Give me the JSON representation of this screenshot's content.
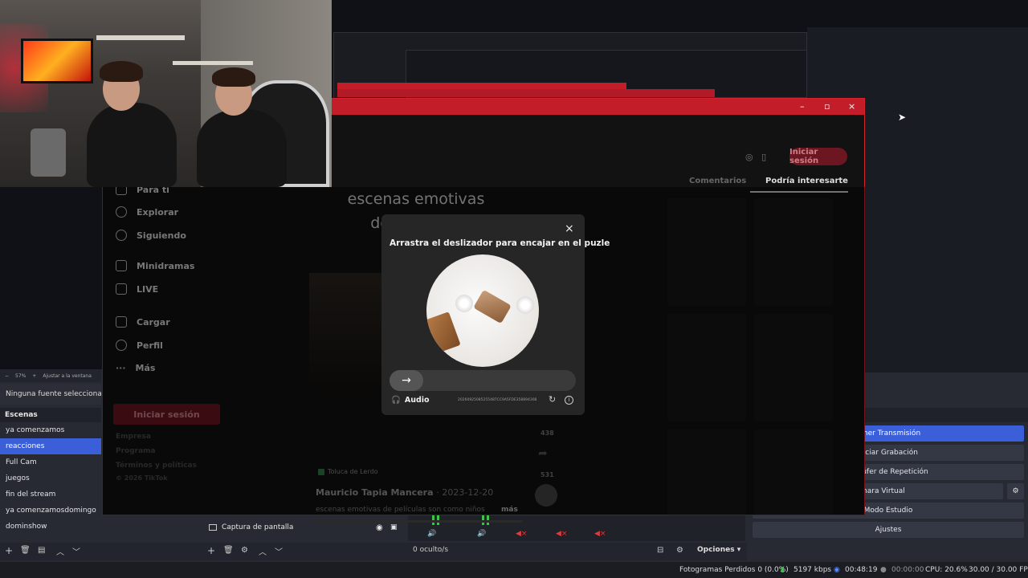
{
  "tiktok": {
    "video_title": "escenas emotivas de películas",
    "nav": [
      "Para ti",
      "Explorar",
      "Siguiendo",
      "Minidramas",
      "LIVE",
      "Cargar",
      "Perfil",
      "Más"
    ],
    "login_side": "Iniciar sesión",
    "login_top": "Iniciar sesión",
    "footer": [
      "Empresa",
      "Programa",
      "Términos y políticas",
      "© 2026 TikTok"
    ],
    "tabs": {
      "comments": "Comentarios",
      "interest": "Podría interesarte"
    },
    "location": "Toluca de Lerdo",
    "author": "Mauricio Tapia Mancera",
    "date": "· 2023-12-20",
    "caption": "escenas emotivas de películas son como niños",
    "more": "más",
    "counts": {
      "saves": "438",
      "shares": "531"
    }
  },
  "captcha": {
    "close": "×",
    "title": "Arrastra el deslizador para encajar en el puzle",
    "slider_arrow": "→",
    "audio_label": "Audio",
    "code": "20260925085255487CC9A5FDE358894308",
    "refresh": "↻",
    "info": "i"
  },
  "obs": {
    "zoom": {
      "minus": "−",
      "value": "57%",
      "plus": "+",
      "fit": "Ajustar a la ventana"
    },
    "no_source": "Ninguna fuente seleccionada",
    "scenes_header": "Escenas",
    "scenes": [
      "ya comenzamos",
      "reacciones",
      "Full Cam",
      "juegos",
      "fin del stream",
      "ya comenzamosdomingo",
      "dominshow"
    ],
    "active_scene_index": 1,
    "source": "Captura de pantalla",
    "hidden_count": "0 oculto/s",
    "options": "Opciones",
    "controls": [
      "tener Transmisión",
      "niciar Grabación",
      "el Búfer de Repetición",
      "Cámara Virtual",
      "Modo Estudio",
      "Ajustes"
    ],
    "status": {
      "dropped": "Fotogramas Perdidos 0 (0.0%)",
      "bitrate": "5197 kbps",
      "stream_time": "00:48:19",
      "rec_time": "00:00:00",
      "cpu": "CPU: 20.6%",
      "fps": "30.00 / 30.00 FPS"
    },
    "meter_labels": [
      "-60",
      "-60",
      "-60",
      "-60",
      "-60",
      "-60"
    ]
  },
  "colors": {
    "obs_accent": "#3a5fd9",
    "tiktok_red": "#c31d2a",
    "stream_green": "#3ec24a"
  }
}
